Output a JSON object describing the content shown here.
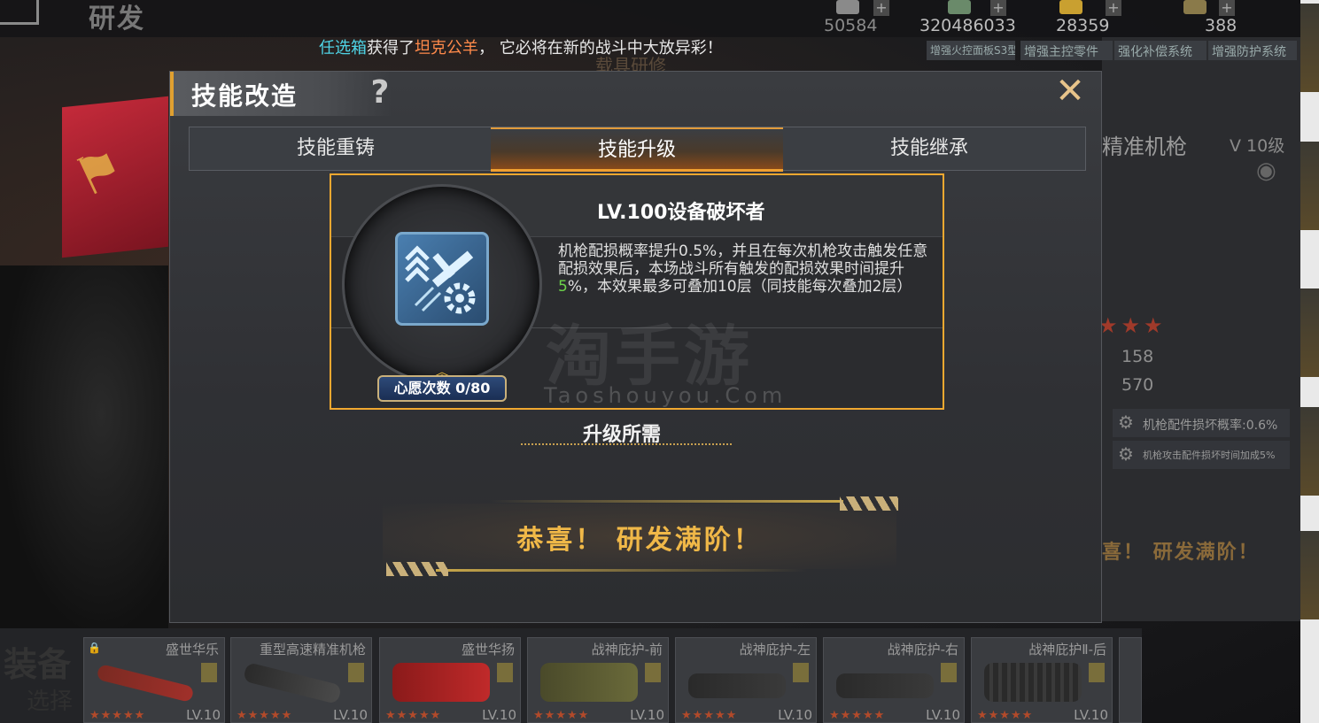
{
  "top_bar": {
    "page_title": "研发",
    "resources": [
      {
        "icon": "silver-coin-icon",
        "value": "50584"
      },
      {
        "icon": "cash-icon",
        "value": "320486033"
      },
      {
        "icon": "gold-bar-icon",
        "value": "28359"
      },
      {
        "icon": "feather-icon",
        "value": "388"
      }
    ]
  },
  "broadcast": {
    "part1": "任选箱",
    "part2": "获得了",
    "part3": "坦克公羊",
    "part4": "， 它必将在新的战斗中大放异彩！"
  },
  "background_panel": {
    "tabs": [
      "增强火控面板S3型",
      "增强主控零件",
      "强化补偿系统",
      "增强防护系统"
    ],
    "weapon_name": "精准机枪",
    "weapon_level": "V 10级",
    "stats": [
      "158",
      "570"
    ],
    "skills": [
      "机枪配件损坏概率:0.6%",
      "机枪攻击配件损坏时间加成5%"
    ],
    "max_text": "喜！ 研发满阶！",
    "faded_label": "载具研修"
  },
  "equipment_bar": {
    "label": "装备",
    "select_label": "选择",
    "items": [
      {
        "name": "盛世华乐",
        "level": "LV.10",
        "locked": true
      },
      {
        "name": "重型高速精准机枪",
        "level": "LV.10"
      },
      {
        "name": "盛世华扬",
        "level": "LV.10"
      },
      {
        "name": "战神庇护-前",
        "level": "LV.10"
      },
      {
        "name": "战神庇护-左",
        "level": "LV.10"
      },
      {
        "name": "战神庇护-右",
        "level": "LV.10"
      },
      {
        "name": "战神庇护Ⅱ-后",
        "level": "LV.10"
      }
    ]
  },
  "dialog": {
    "title": "技能改造",
    "help": "?",
    "close": "✕",
    "tabs": [
      {
        "label": "技能重铸",
        "active": false
      },
      {
        "label": "技能升级",
        "active": true
      },
      {
        "label": "技能继承",
        "active": false
      }
    ],
    "skill": {
      "name": "LV.100设备破坏者",
      "description_1": "机枪配损概率提升0.5%，并且在每次机枪攻击触发任意配损效果后，本场战斗所有触发的配损效果时间提升",
      "description_highlight": "5",
      "description_2": "%，本效果最多可叠加10层（同技能每次叠加2层）",
      "wish_count": "心愿次数 0/80"
    },
    "requirement_title": "升级所需",
    "max_text": "恭喜！ 研发满阶！"
  },
  "watermark": {
    "cn": "淘手游",
    "en": "Taoshouyou.Com"
  },
  "colors": {
    "accent_orange": "#f0a830",
    "max_gold": "#f0b848",
    "highlight_green": "#6cd24a",
    "broadcast_cyan": "#4fd4e6",
    "broadcast_orange": "#ff8a4a"
  }
}
